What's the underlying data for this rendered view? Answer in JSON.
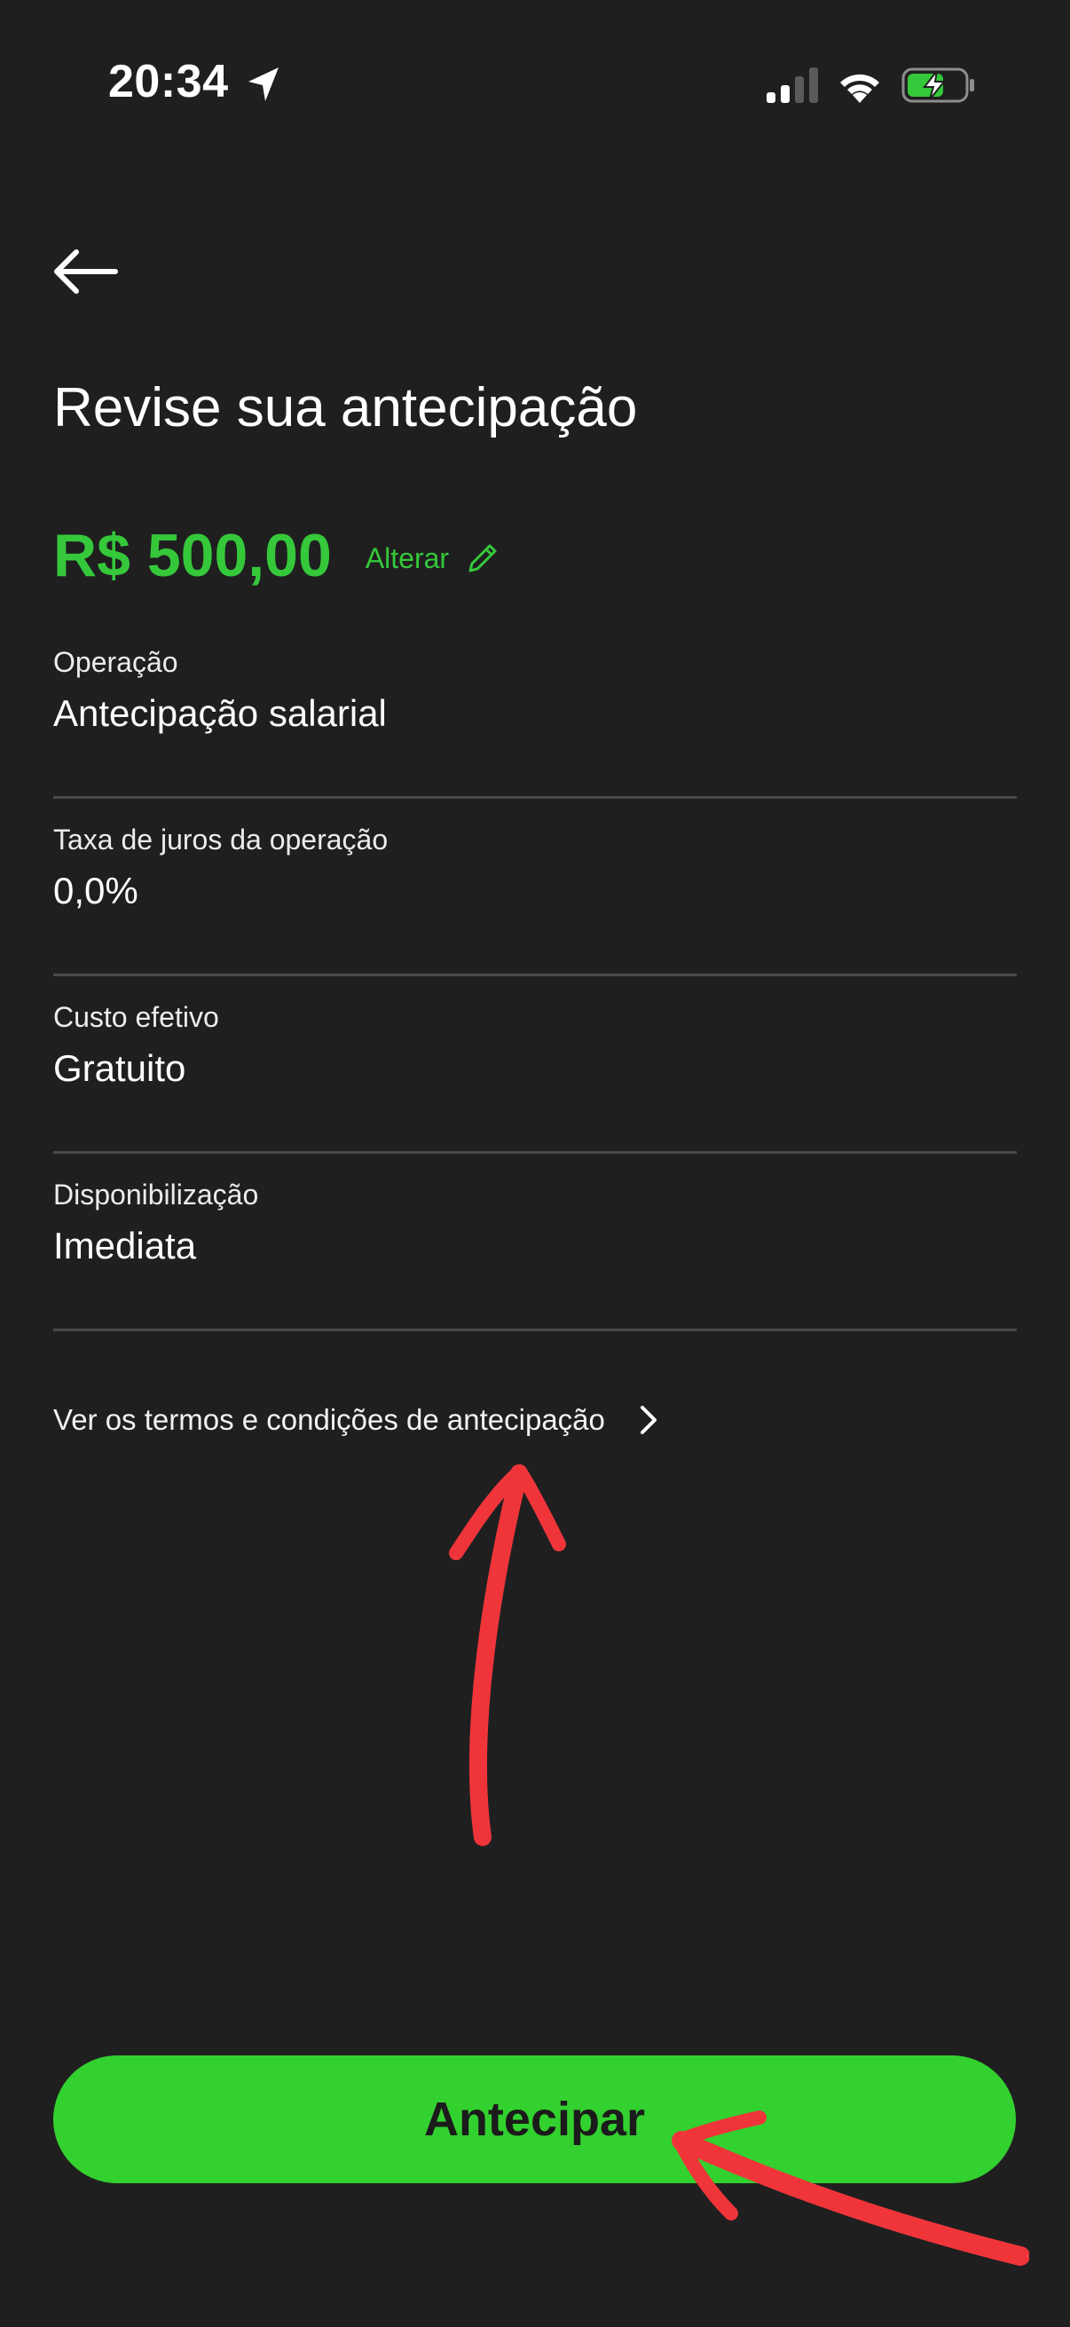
{
  "status_bar": {
    "time": "20:34",
    "icons": [
      "location-arrow-icon",
      "signal-icon",
      "wifi-icon",
      "battery-charging-icon"
    ]
  },
  "header": {
    "back_icon": "arrow-left-icon"
  },
  "page": {
    "title": "Revise sua antecipação"
  },
  "amount": {
    "value": "R$ 500,00",
    "alter_label": "Alterar",
    "alter_icon": "pencil-icon"
  },
  "details": [
    {
      "label": "Operação",
      "value": "Antecipação salarial"
    },
    {
      "label": "Taxa de juros da operação",
      "value": "0,0%"
    },
    {
      "label": "Custo efetivo",
      "value": "Gratuito"
    },
    {
      "label": "Disponibilização",
      "value": "Imediata"
    }
  ],
  "terms": {
    "label": "Ver os termos e condições de antecipação",
    "icon": "chevron-right-icon"
  },
  "footer": {
    "primary_label": "Antecipar"
  },
  "colors": {
    "background": "#1f1f20",
    "accent_green": "#35c83a",
    "button_green": "#33d12f",
    "divider": "#4a4a4c",
    "annotation_red": "#f0353a"
  }
}
